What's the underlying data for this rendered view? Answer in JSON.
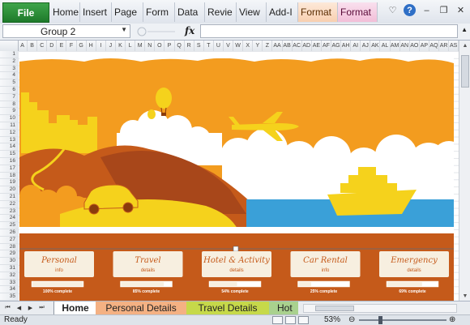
{
  "ribbon": {
    "file_label": "File",
    "tabs": [
      {
        "label": "Home"
      },
      {
        "label": "Insert"
      },
      {
        "label": "Page"
      },
      {
        "label": "Form"
      },
      {
        "label": "Data"
      },
      {
        "label": "Revie"
      },
      {
        "label": "View"
      },
      {
        "label": "Add-I"
      },
      {
        "label": "Format"
      },
      {
        "label": "Format"
      }
    ],
    "icons": [
      "heart-icon",
      "help-icon",
      "minimize-icon",
      "restore-icon",
      "close-icon"
    ]
  },
  "formula_bar": {
    "name_box": "Group 2",
    "fx_label": "fx",
    "formula": ""
  },
  "grid": {
    "columns": [
      "A",
      "B",
      "C",
      "D",
      "E",
      "F",
      "G",
      "H",
      "I",
      "J",
      "K",
      "L",
      "M",
      "N",
      "O",
      "P",
      "Q",
      "R",
      "S",
      "T",
      "U",
      "V",
      "W",
      "X",
      "Y",
      "Z",
      "AA",
      "AB",
      "AC",
      "AD",
      "AE",
      "AF",
      "AG",
      "AH",
      "AI",
      "AJ",
      "AK",
      "AL",
      "AM",
      "AN",
      "AO",
      "AP",
      "AQ",
      "AR",
      "AS"
    ],
    "rows": [
      "1",
      "2",
      "3",
      "4",
      "5",
      "6",
      "7",
      "8",
      "9",
      "10",
      "11",
      "12",
      "13",
      "14",
      "15",
      "16",
      "17",
      "18",
      "19",
      "20",
      "21",
      "22",
      "23",
      "24",
      "25",
      "26",
      "27",
      "28",
      "29",
      "30",
      "31",
      "32",
      "33",
      "34",
      "35"
    ]
  },
  "dashboard": {
    "buttons": [
      {
        "title": "Personal",
        "sub": "info",
        "progress": "100% complete",
        "progress_value": 1.0
      },
      {
        "title": "Travel",
        "sub": "details",
        "progress": "85% complete",
        "progress_value": 0.85
      },
      {
        "title": "Hotel & Activity",
        "sub": "details",
        "progress": "54% complete",
        "progress_value": 0.54
      },
      {
        "title": "Car Rental",
        "sub": "info",
        "progress": "25% complete",
        "progress_value": 0.25
      },
      {
        "title": "Emergency",
        "sub": "details",
        "progress": "69% complete",
        "progress_value": 0.69
      }
    ]
  },
  "sheets": {
    "tabs": [
      {
        "label": "Home",
        "active": true,
        "color": "#ffffff"
      },
      {
        "label": "Personal Details",
        "active": false,
        "color": "#f4b183"
      },
      {
        "label": "Travel Details",
        "active": false,
        "color": "#c6d94a"
      },
      {
        "label": "Hot",
        "active": false,
        "color": "#a9d18e"
      }
    ]
  },
  "status": {
    "ready": "Ready",
    "zoom": "53%"
  },
  "colors": {
    "sky": "#f39c1f",
    "banner": "#c55a1a",
    "sea": "#3aa0d8",
    "accent_yellow": "#f5d21c",
    "card": "#f7efe0",
    "card_text": "#c55a1a"
  }
}
